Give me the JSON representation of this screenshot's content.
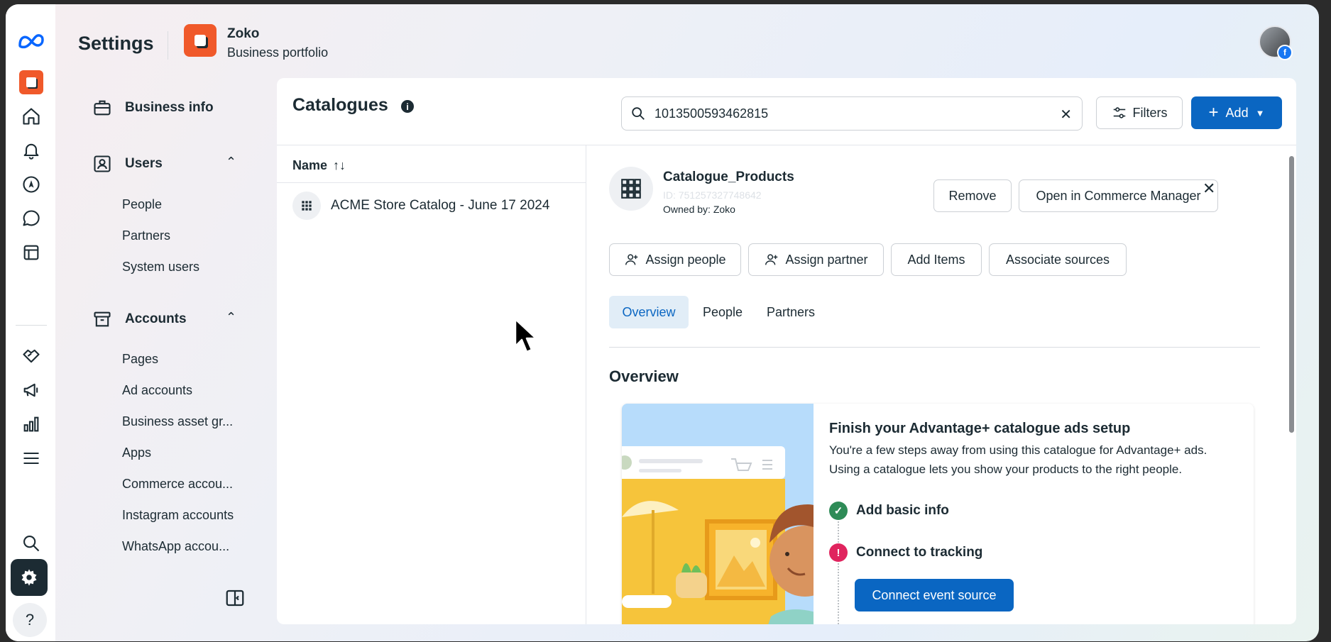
{
  "header": {
    "title": "Settings",
    "business_name": "Zoko",
    "business_subtitle": "Business portfolio"
  },
  "nav": {
    "business_info": "Business info",
    "users": {
      "label": "Users",
      "items": [
        "People",
        "Partners",
        "System users"
      ]
    },
    "accounts": {
      "label": "Accounts",
      "items": [
        "Pages",
        "Ad accounts",
        "Business asset gr...",
        "Apps",
        "Commerce accou...",
        "Instagram accounts",
        "WhatsApp accou..."
      ]
    }
  },
  "catalogues": {
    "title": "Catalogues",
    "search_value": "1013500593462815",
    "filters_label": "Filters",
    "add_label": "Add",
    "column_name": "Name",
    "sort_glyph": "↑↓",
    "rows": [
      {
        "name": "ACME Store Catalog - June 17 2024"
      }
    ]
  },
  "detail": {
    "name": "Catalogue_Products",
    "id": "ID: 751257327748642",
    "owner": "Owned by: Zoko",
    "remove_label": "Remove",
    "open_label": "Open in Commerce Manager",
    "actions": {
      "assign_people": "Assign people",
      "assign_partner": "Assign partner",
      "add_items": "Add Items",
      "associate_sources": "Associate sources"
    },
    "tabs": {
      "overview": "Overview",
      "people": "People",
      "partners": "Partners"
    },
    "overview_heading": "Overview",
    "promo": {
      "title": "Finish your Advantage+ catalogue ads setup",
      "body": "You're a few steps away from using this catalogue for Advantage+ ads. Using a catalogue lets you show your products to the right people.",
      "step1": "Add basic info",
      "step2": "Connect to tracking",
      "cta": "Connect event source"
    }
  },
  "colors": {
    "accent": "#0a66c2",
    "brand_orange": "#f0592a",
    "success": "#2e8b57",
    "error": "#e0245e"
  }
}
